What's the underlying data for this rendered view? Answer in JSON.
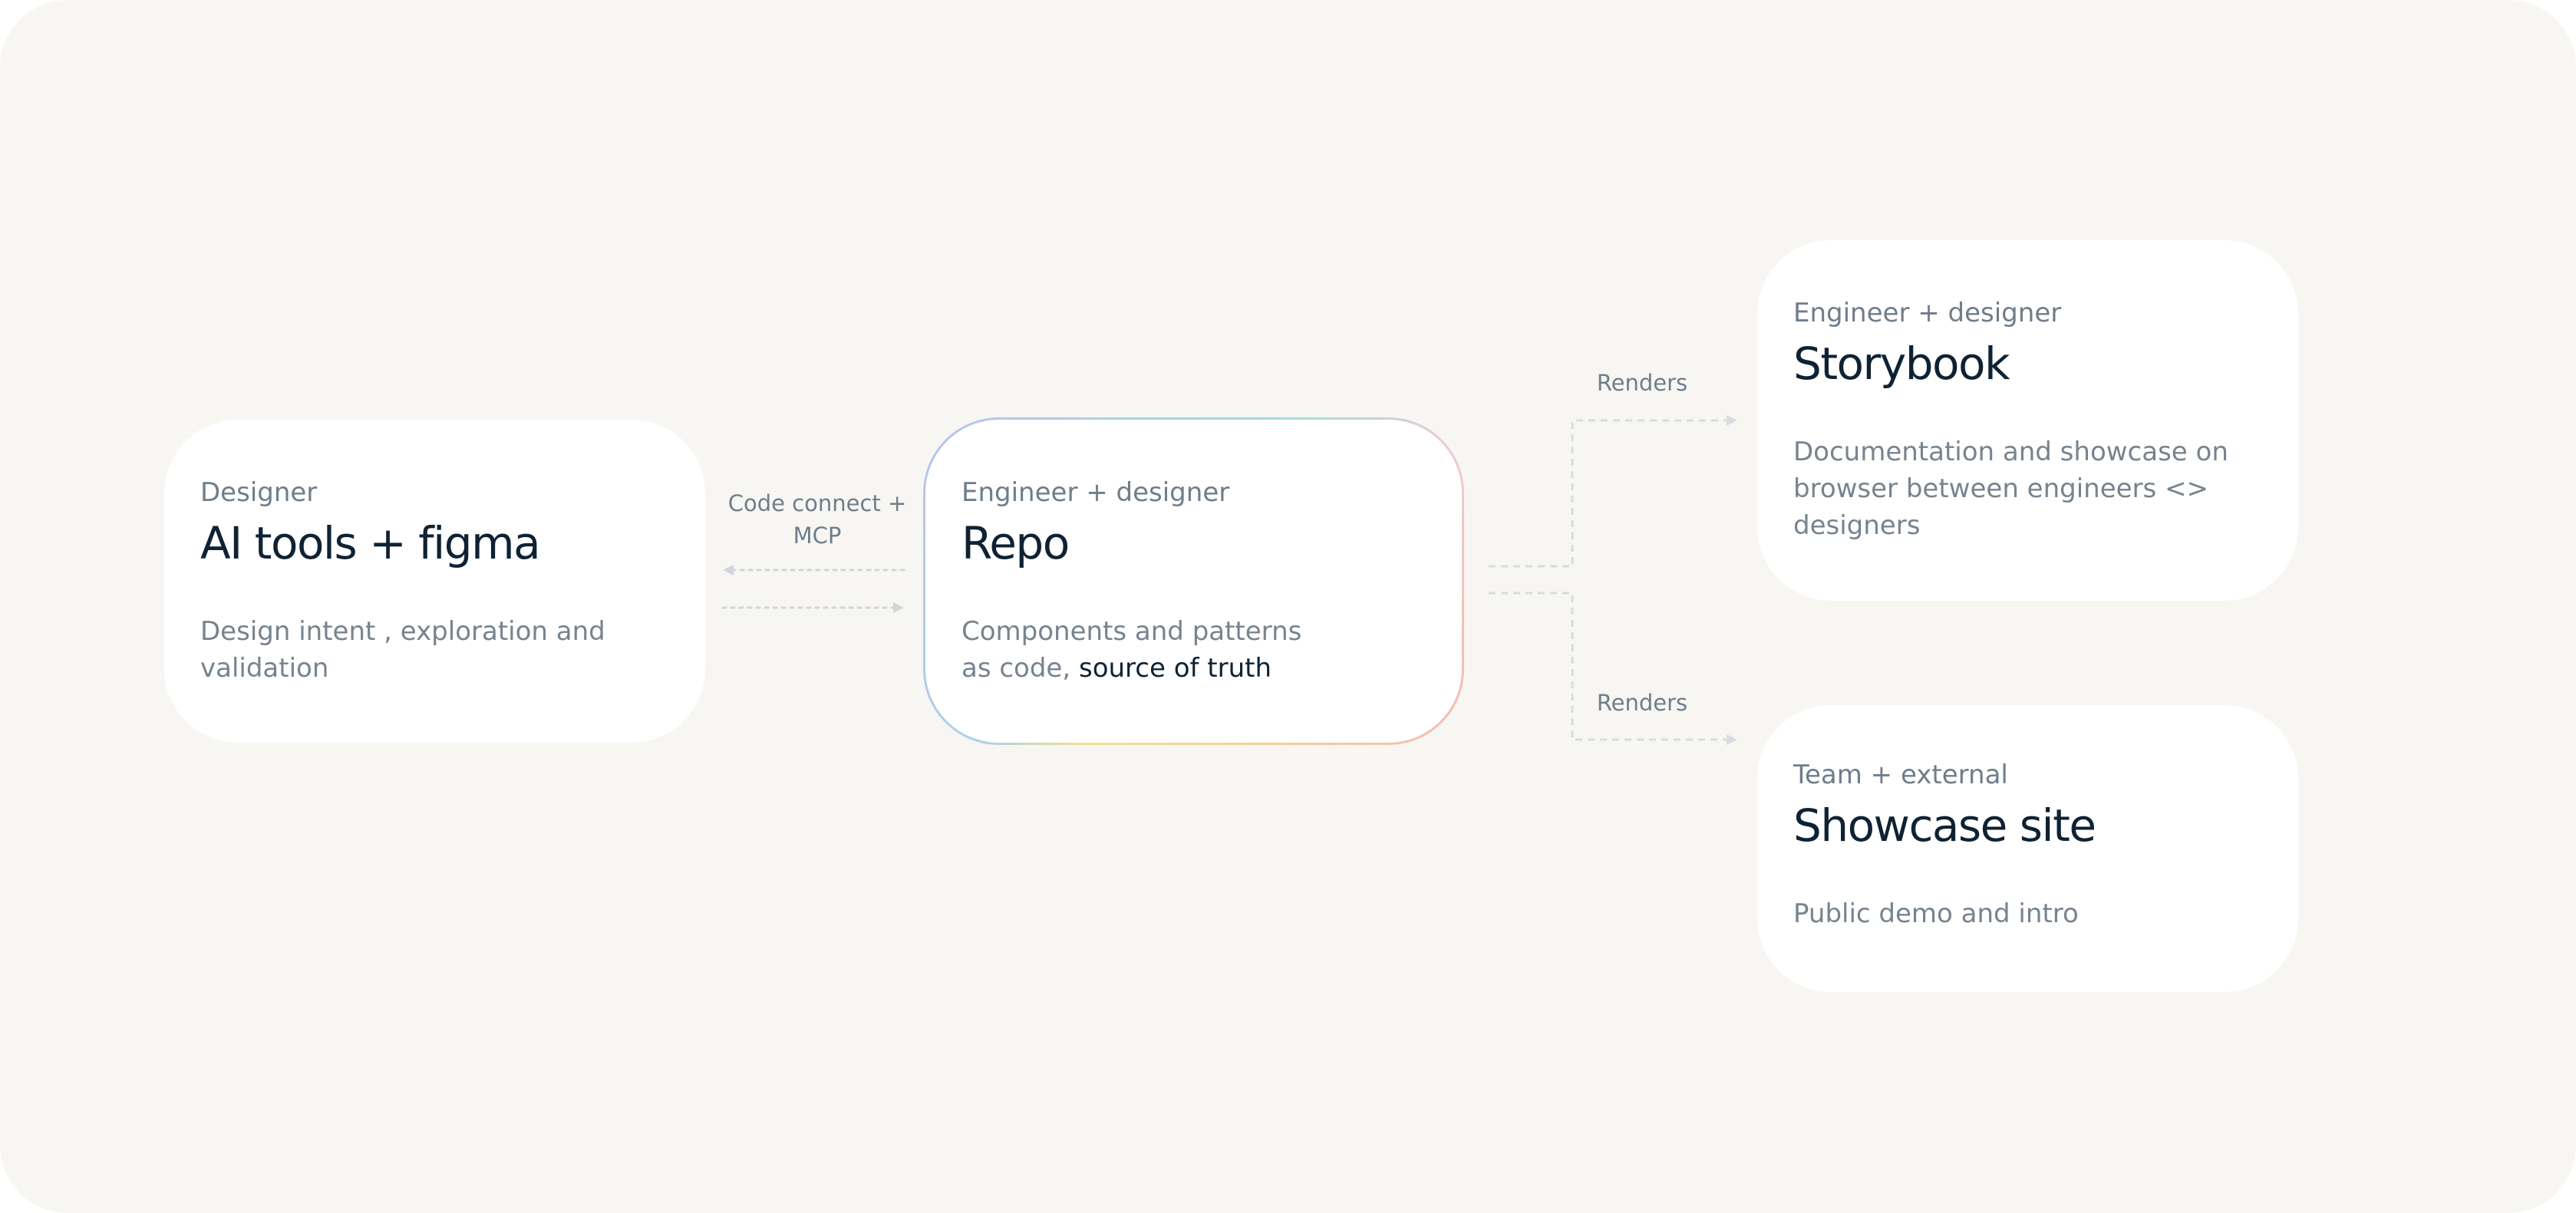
{
  "nodes": {
    "ai_tools": {
      "role": "Designer",
      "title": "AI tools + figma",
      "description_lines": [
        "Design intent , exploration and",
        "validation"
      ]
    },
    "repo": {
      "role": "Engineer + designer",
      "title": "Repo",
      "description_line1": "Components and patterns",
      "description_line2_prefix": "as code,",
      "description_line2_highlight": "source of truth"
    },
    "storybook": {
      "role": "Engineer + designer",
      "title": "Storybook",
      "description_lines": [
        "Documentation and showcase on",
        "browser between engineers <>",
        "designers"
      ]
    },
    "showcase": {
      "role": "Team + external",
      "title": "Showcase site",
      "description_lines": [
        "Public demo and intro"
      ]
    }
  },
  "edges": {
    "ai_repo_lines": [
      "Code connect +",
      "MCP"
    ],
    "repo_storybook": "Renders",
    "repo_showcase": "Renders"
  },
  "colors": {
    "background": "#f7f6f3",
    "card": "#ffffff",
    "title": "#0f2233",
    "muted_text": "#6f7d8a",
    "connector": "#cfd6dc",
    "highlight_text": "#0f2233"
  }
}
